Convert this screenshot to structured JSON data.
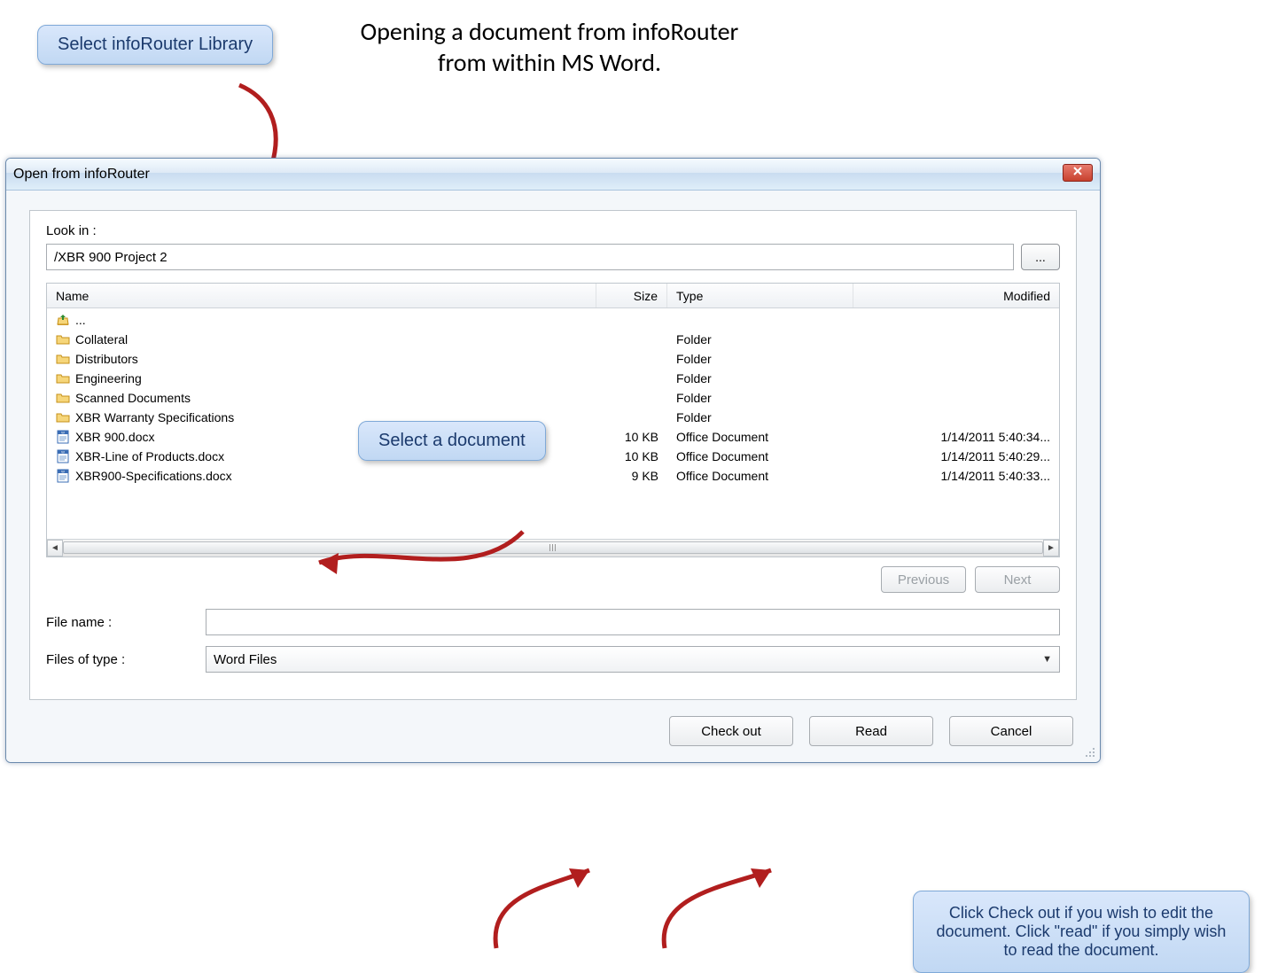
{
  "page": {
    "title_line1": "Opening a document from infoRouter",
    "title_line2": "from within MS Word."
  },
  "callouts": {
    "select_library": "Select infoRouter Library",
    "select_document": "Select a document",
    "bottom_help": "Click Check out if you wish to edit the document. Click \"read\" if you simply wish to read the document."
  },
  "dialog": {
    "title": "Open from infoRouter",
    "look_in_label": "Look in :",
    "path_value": "/XBR 900 Project 2",
    "browse_label": "...",
    "columns": {
      "name": "Name",
      "size": "Size",
      "type": "Type",
      "modified": "Modified"
    },
    "rows": [
      {
        "icon": "up",
        "name": "...",
        "size": "",
        "type": "",
        "modified": ""
      },
      {
        "icon": "folder",
        "name": "Collateral",
        "size": "",
        "type": "Folder",
        "modified": ""
      },
      {
        "icon": "folder",
        "name": "Distributors",
        "size": "",
        "type": "Folder",
        "modified": ""
      },
      {
        "icon": "folder",
        "name": "Engineering",
        "size": "",
        "type": "Folder",
        "modified": ""
      },
      {
        "icon": "folder",
        "name": "Scanned Documents",
        "size": "",
        "type": "Folder",
        "modified": ""
      },
      {
        "icon": "folder",
        "name": "XBR Warranty Specifications",
        "size": "",
        "type": "Folder",
        "modified": ""
      },
      {
        "icon": "doc",
        "name": "XBR 900.docx",
        "size": "10 KB",
        "type": "Office Document",
        "modified": "1/14/2011 5:40:34..."
      },
      {
        "icon": "doc",
        "name": "XBR-Line of Products.docx",
        "size": "10 KB",
        "type": "Office Document",
        "modified": "1/14/2011 5:40:29..."
      },
      {
        "icon": "doc",
        "name": "XBR900-Specifications.docx",
        "size": "9 KB",
        "type": "Office Document",
        "modified": "1/14/2011 5:40:33..."
      }
    ],
    "nav": {
      "previous": "Previous",
      "next": "Next"
    },
    "file_name_label": "File name :",
    "file_name_value": "",
    "files_of_type_label": "Files of type :",
    "files_of_type_value": "Word Files",
    "actions": {
      "checkout": "Check out",
      "read": "Read",
      "cancel": "Cancel"
    }
  }
}
